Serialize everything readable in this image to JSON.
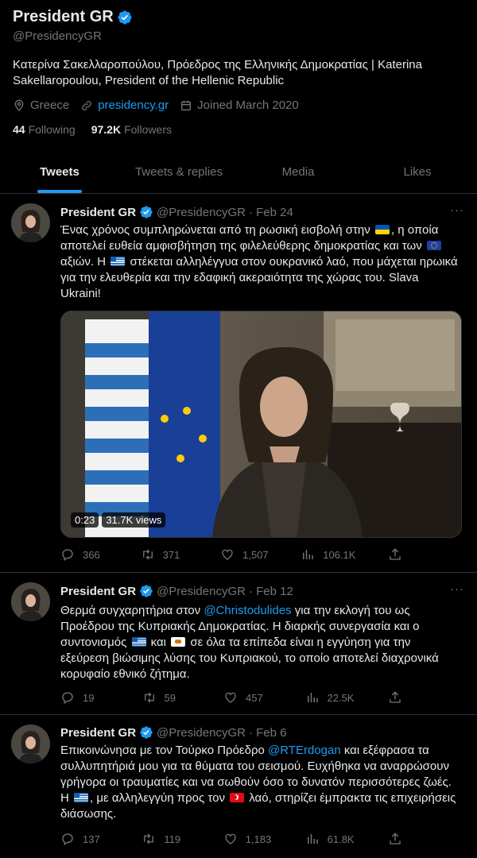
{
  "profile": {
    "name": "President GR",
    "handle": "@PresidencyGR",
    "bio": "Κατερίνα Σακελλαροπούλου, Πρόεδρος της Ελληνικής Δημοκρατίας | Katerina Sakellaropoulou, President of the Hellenic Republic",
    "location": "Greece",
    "website": "presidency.gr",
    "joined": "Joined March 2020",
    "following_count": "44",
    "following_label": "Following",
    "followers_count": "97.2K",
    "followers_label": "Followers"
  },
  "tabs": [
    "Tweets",
    "Tweets & replies",
    "Media",
    "Likes"
  ],
  "tweets": [
    {
      "name": "President GR",
      "handle": "@PresidencyGR",
      "date": "· Feb 24",
      "more": "···",
      "text_1": "Ένας χρόνος συμπληρώνεται από τη ρωσική εισβολή στην",
      "text_2": ", η οποία αποτελεί ευθεία αμφισβήτηση της φιλελεύθερης δημοκρατίας και των",
      "text_3": "αξιών. Η",
      "text_4": "στέκεται αλληλέγγυα στον ουκρανικό λαό, που μάχεται ηρωικά για την ελευθερία και την εδαφική ακεραιότητα της χώρας του. Slava Ukraini!",
      "video_time": "0:23",
      "video_views": "31.7K views",
      "replies": "366",
      "retweets": "371",
      "likes": "1,507",
      "views": "106.1K"
    },
    {
      "name": "President GR",
      "handle": "@PresidencyGR",
      "date": "· Feb 12",
      "more": "···",
      "text_1": "Θερμά συγχαρητήρια στον",
      "mention": "@Christodulides",
      "text_2": "για την εκλογή του ως Προέδρου της Κυπριακής Δημοκρατίας. Η διαρκής συνεργασία και ο συντονισμός",
      "text_3": "και",
      "text_4": "σε όλα τα επίπεδα είναι η εγγύηση για την εξεύρεση βιώσιμης λύσης του Κυπριακού, το οποίο αποτελεί διαχρονικά κορυφαίο εθνικό ζήτημα.",
      "replies": "19",
      "retweets": "59",
      "likes": "457",
      "views": "22.5K"
    },
    {
      "name": "President GR",
      "handle": "@PresidencyGR",
      "date": "· Feb 6",
      "more": "···",
      "text_1": "Επικοινώνησα με τον Τούρκο Πρόεδρο",
      "mention": "@RTErdogan",
      "text_2": "και εξέφρασα τα συλλυπητήριά μου για τα θύματα του σεισμού. Ευχήθηκα να αναρρώσουν γρήγορα οι τραυματίες και να σωθούν όσο το δυνατόν περισσότερες ζωές. Η",
      "text_3": ", με αλληλεγγύη προς τον",
      "text_4": "λαό, στηρίζει έμπρακτα τις επιχειρήσεις διάσωσης.",
      "replies": "137",
      "retweets": "119",
      "likes": "1,183",
      "views": "61.8K"
    }
  ],
  "colors": {
    "accent": "#1d9bf0",
    "muted": "#71767b",
    "background": "#000000",
    "text": "#e7e9ea"
  }
}
